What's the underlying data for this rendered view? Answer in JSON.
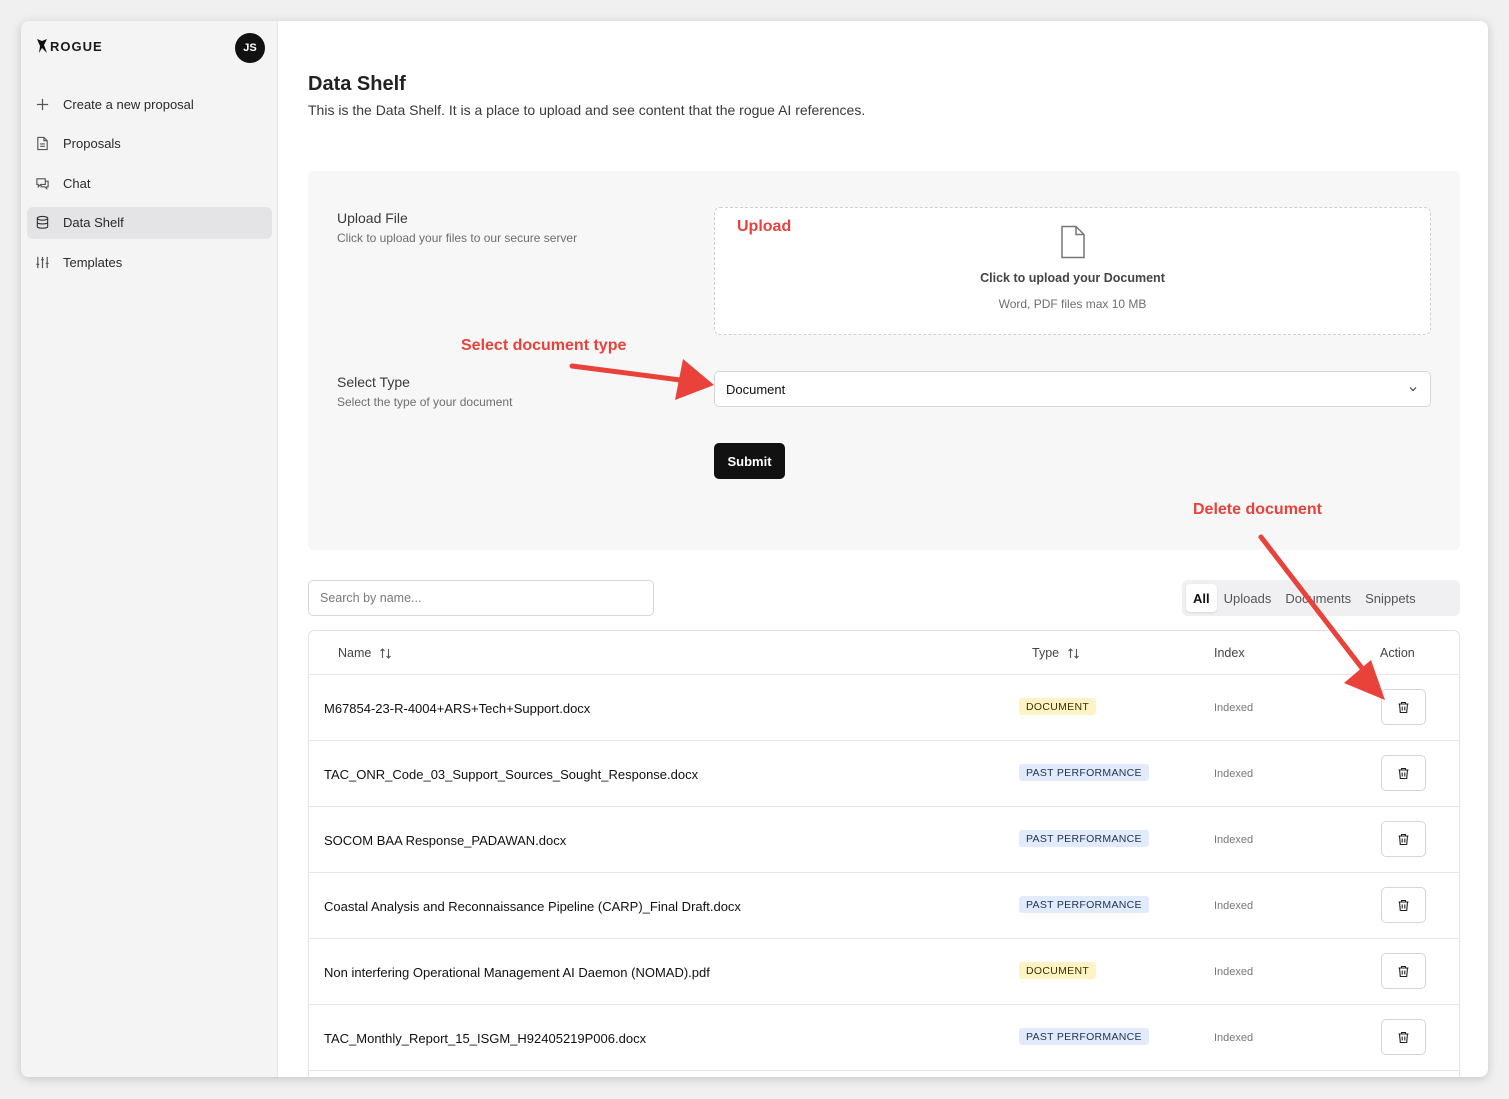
{
  "app": {
    "brand": "ROGUE",
    "avatar_initials": "JS"
  },
  "sidebar": {
    "items": [
      {
        "label": "Create a new proposal",
        "icon": "plus-icon"
      },
      {
        "label": "Proposals",
        "icon": "file-icon"
      },
      {
        "label": "Chat",
        "icon": "chat-icon"
      },
      {
        "label": "Data Shelf",
        "icon": "database-icon",
        "active": true
      },
      {
        "label": "Templates",
        "icon": "sliders-icon"
      }
    ]
  },
  "page": {
    "title": "Data Shelf",
    "description": "This is the Data Shelf. It is a place to upload and see content that the rogue AI references."
  },
  "upload": {
    "label": "Upload File",
    "sublabel": "Click to upload your files to our secure server",
    "dropzone_title": "Click to upload your Document",
    "dropzone_sub": "Word, PDF files max 10 MB"
  },
  "select_type": {
    "label": "Select Type",
    "sublabel": "Select the type of your document",
    "value": "Document"
  },
  "submit_label": "Submit",
  "search": {
    "placeholder": "Search by name..."
  },
  "filter_tabs": [
    {
      "label": "All",
      "active": true
    },
    {
      "label": "Uploads"
    },
    {
      "label": "Documents"
    },
    {
      "label": "Snippets"
    }
  ],
  "table": {
    "headers": {
      "name": "Name",
      "type": "Type",
      "index": "Index",
      "action": "Action"
    },
    "rows": [
      {
        "name": "M67854-23-R-4004+ARS+Tech+Support.docx",
        "type": "DOCUMENT",
        "index": "Indexed"
      },
      {
        "name": "TAC_ONR_Code_03_Support_Sources_Sought_Response.docx",
        "type": "PAST PERFORMANCE",
        "index": "Indexed"
      },
      {
        "name": "SOCOM BAA Response_PADAWAN.docx",
        "type": "PAST PERFORMANCE",
        "index": "Indexed"
      },
      {
        "name": "Coastal Analysis and Reconnaissance Pipeline (CARP)_Final Draft.docx",
        "type": "PAST PERFORMANCE",
        "index": "Indexed"
      },
      {
        "name": "Non interfering Operational Management AI Daemon (NOMAD).pdf",
        "type": "DOCUMENT",
        "index": "Indexed"
      },
      {
        "name": "TAC_Monthly_Report_15_ISGM_H92405219P006.docx",
        "type": "PAST PERFORMANCE",
        "index": "Indexed"
      }
    ]
  },
  "annotations": {
    "upload": "Upload",
    "select_type": "Select document type",
    "delete": "Delete document"
  },
  "colors": {
    "annotation": "#e8423a",
    "document_badge": "#fdf3c4",
    "past_performance_badge": "#e1ebfb",
    "primary_button": "#111111"
  }
}
